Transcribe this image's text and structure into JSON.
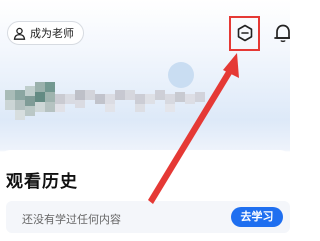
{
  "header": {
    "teacher_button_label": "成为老师",
    "teacher_icon": "person-icon",
    "action_icon": "minus-circle-icon",
    "bell_icon": "bell-icon"
  },
  "history": {
    "title": "观看历史",
    "empty_text": "还没有学过任何内容",
    "cta_label": "去学习"
  },
  "annotation": {
    "color": "#e53935"
  },
  "colors": {
    "accent": "#1f6ff0"
  }
}
